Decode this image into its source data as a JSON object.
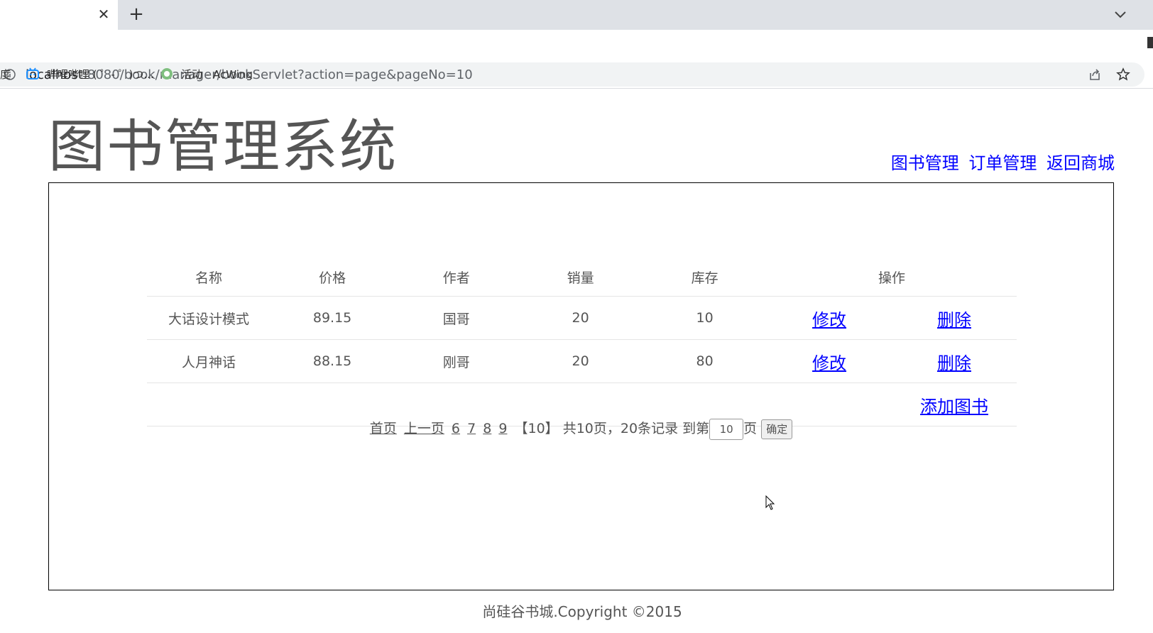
{
  "browser": {
    "tab_close": "✕",
    "new_tab": "+",
    "url_host": "localhost",
    "url_rest": ":8080/book/manager/bookServlet?action=page&pageNo=10",
    "bookmarks": [
      {
        "label": "度",
        "icon": "text-fragment"
      },
      {
        "label": "哔哩哔哩 ( ゜- ゜)つ...",
        "icon": "bilibili-icon"
      },
      {
        "label": "活动 - AcWing",
        "icon": "acwing-icon"
      }
    ]
  },
  "header": {
    "title": "图书管理系统",
    "nav": [
      "图书管理",
      "订单管理",
      "返回商城"
    ]
  },
  "table": {
    "headers": [
      "名称",
      "价格",
      "作者",
      "销量",
      "库存",
      "操作"
    ],
    "rows": [
      {
        "name": "大话设计模式",
        "price": "89.15",
        "author": "国哥",
        "sales": "20",
        "stock": "10",
        "edit": "修改",
        "delete": "删除"
      },
      {
        "name": "人月神话",
        "price": "88.15",
        "author": "刚哥",
        "sales": "20",
        "stock": "80",
        "edit": "修改",
        "delete": "删除"
      }
    ],
    "add_book": "添加图书"
  },
  "pager": {
    "first": "首页",
    "prev": "上一页",
    "pages": [
      "6",
      "7",
      "8",
      "9"
    ],
    "current": "【10】",
    "summary": "共10页，20条记录 到第",
    "input_value": "10",
    "page_suffix": "页",
    "confirm": "确定"
  },
  "footer": {
    "text": "尚硅谷书城.Copyright ©2015"
  }
}
